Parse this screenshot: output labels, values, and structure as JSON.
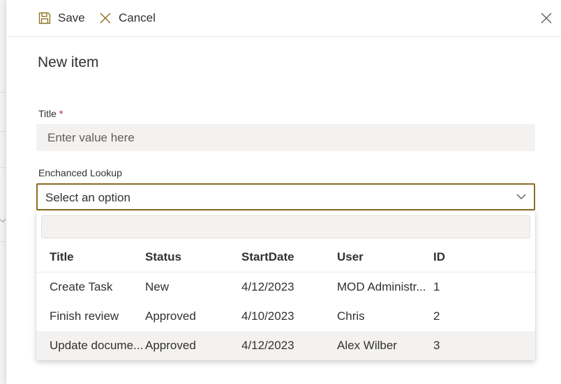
{
  "toolbar": {
    "save_label": "Save",
    "cancel_label": "Cancel",
    "save_icon": "floppy-disk-icon",
    "cancel_icon": "x-icon",
    "close_icon": "close-icon"
  },
  "form": {
    "title": "New item",
    "fields": {
      "title": {
        "label": "Title",
        "required_marker": "*",
        "placeholder": "Enter value here",
        "value": ""
      },
      "lookup": {
        "label": "Enchanced Lookup",
        "placeholder": "Select an option"
      }
    }
  },
  "lookup_table": {
    "search_value": "",
    "columns": [
      "Title",
      "Status",
      "StartDate",
      "User",
      "ID"
    ],
    "rows": [
      [
        "Create Task",
        "New",
        "4/12/2023",
        "MOD Administr...",
        "1"
      ],
      [
        "Finish review",
        "Approved",
        "4/10/2023",
        "Chris",
        "2"
      ],
      [
        "Update docume...",
        "Approved",
        "4/12/2023",
        "Alex Wilber",
        "3"
      ]
    ],
    "highlighted_row": 2
  },
  "colors": {
    "accent": "#8a6d1f",
    "required": "#a4262c",
    "field_bg": "#f3f2f1",
    "text": "#323130"
  }
}
